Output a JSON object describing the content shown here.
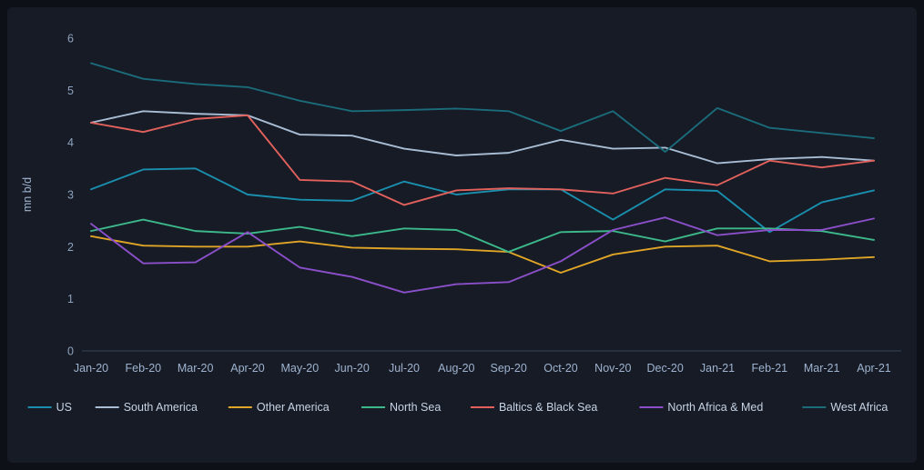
{
  "chart_data": {
    "type": "line",
    "title": "",
    "subtitle": "",
    "xlabel": "",
    "ylabel": "mn b/d",
    "ylim": [
      0,
      6
    ],
    "ytick_values": [
      0,
      1,
      2,
      3,
      4,
      5,
      6
    ],
    "ytick_labels": [
      "0",
      "1",
      "2",
      "3",
      "4",
      "5",
      "6"
    ],
    "grid": false,
    "legend_position": "bottom",
    "categories": [
      "Jan-20",
      "Feb-20",
      "Mar-20",
      "Apr-20",
      "May-20",
      "Jun-20",
      "Jul-20",
      "Aug-20",
      "Sep-20",
      "Oct-20",
      "Nov-20",
      "Dec-20",
      "Jan-21",
      "Feb-21",
      "Mar-21",
      "Apr-21"
    ],
    "series": [
      {
        "name": "US",
        "color": "#1a8fae",
        "values": [
          3.1,
          3.48,
          3.5,
          3.0,
          2.9,
          2.88,
          3.25,
          3.0,
          3.1,
          3.1,
          2.52,
          3.1,
          3.07,
          2.28,
          2.85,
          3.08
        ]
      },
      {
        "name": "South America",
        "color": "#a8bdd4",
        "values": [
          4.38,
          4.6,
          4.55,
          4.52,
          4.15,
          4.13,
          3.88,
          3.75,
          3.8,
          4.05,
          3.88,
          3.9,
          3.6,
          3.68,
          3.72,
          3.65
        ]
      },
      {
        "name": "Other America",
        "color": "#e0a526",
        "values": [
          2.2,
          2.02,
          2.0,
          2.0,
          2.1,
          1.98,
          1.96,
          1.95,
          1.9,
          1.5,
          1.85,
          2.0,
          2.02,
          1.72,
          1.75,
          1.8
        ]
      },
      {
        "name": "North Sea",
        "color": "#3cb88a",
        "values": [
          2.3,
          2.52,
          2.3,
          2.25,
          2.38,
          2.2,
          2.35,
          2.32,
          1.9,
          2.28,
          2.3,
          2.1,
          2.35,
          2.35,
          2.3,
          2.13
        ]
      },
      {
        "name": "Baltics & Black Sea",
        "color": "#e2615c",
        "values": [
          4.38,
          4.2,
          4.45,
          4.52,
          3.28,
          3.25,
          2.8,
          3.08,
          3.12,
          3.1,
          3.02,
          3.32,
          3.18,
          3.65,
          3.52,
          3.65
        ]
      },
      {
        "name": "North Africa & Med",
        "color": "#8b4fc9",
        "values": [
          2.44,
          1.68,
          1.7,
          2.28,
          1.6,
          1.42,
          1.12,
          1.28,
          1.32,
          1.72,
          2.32,
          2.56,
          2.22,
          2.32,
          2.32,
          2.54
        ]
      },
      {
        "name": "West Africa",
        "color": "#1b6b7a",
        "values": [
          5.52,
          5.22,
          5.12,
          5.06,
          4.8,
          4.6,
          4.62,
          4.65,
          4.6,
          4.22,
          4.6,
          3.82,
          4.66,
          4.28,
          4.18,
          4.08
        ]
      }
    ]
  },
  "legend": {
    "items": [
      {
        "label": "US",
        "color": "#1a8fae"
      },
      {
        "label": "South America",
        "color": "#a8bdd4"
      },
      {
        "label": "Other America",
        "color": "#e0a526"
      },
      {
        "label": "North Sea",
        "color": "#3cb88a"
      },
      {
        "label": "Baltics & Black Sea",
        "color": "#e2615c"
      },
      {
        "label": "North Africa & Med",
        "color": "#8b4fc9"
      },
      {
        "label": "West Africa",
        "color": "#1b6b7a"
      }
    ]
  },
  "theme": {
    "page_background": "#0d1117",
    "card_background": "#161b26",
    "axis_color": "#3a4657",
    "tick_text_color": "#8fa3bf",
    "legend_text_color": "#c6d3e4"
  }
}
